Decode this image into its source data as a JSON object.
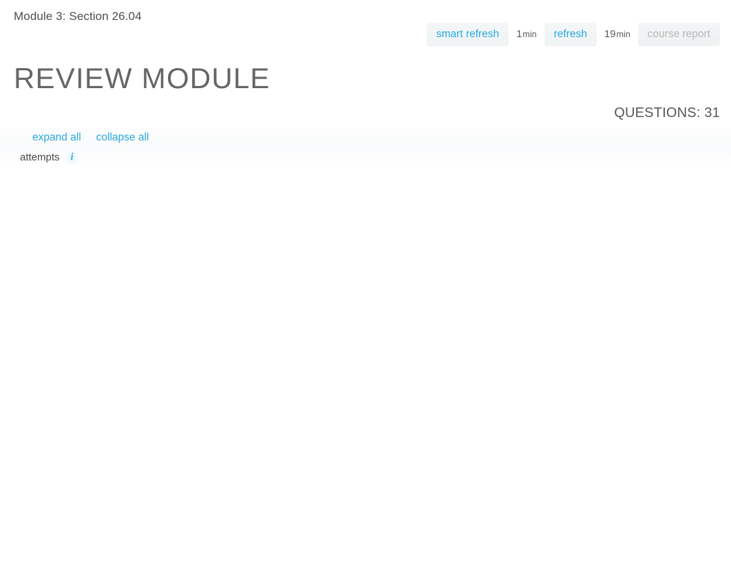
{
  "breadcrumb": {
    "text": "Module 3: Section 26.04"
  },
  "actionbar": {
    "smart_refresh_label": "smart refresh",
    "smart_refresh_time_value": "1",
    "smart_refresh_time_unit": "min",
    "refresh_label": "refresh",
    "refresh_time_value": "19",
    "refresh_time_unit": "min",
    "course_report_label": "course report"
  },
  "page_title": "REVIEW MODULE",
  "questions": {
    "label": "QUESTIONS: 31"
  },
  "toolbar": {
    "expand_all_label": "expand all",
    "collapse_all_label": "collapse all",
    "attempts_label": "attempts",
    "info_icon_glyph": "i",
    "info_icon_name": "info-icon"
  },
  "colors": {
    "link_blue": "#29a8de",
    "disabled_grey": "#b7b7b7",
    "heading_grey": "#666666",
    "text_grey": "#4d4d4d",
    "button_bg": "#f2f5f6",
    "page_bg": "#ffffff"
  }
}
